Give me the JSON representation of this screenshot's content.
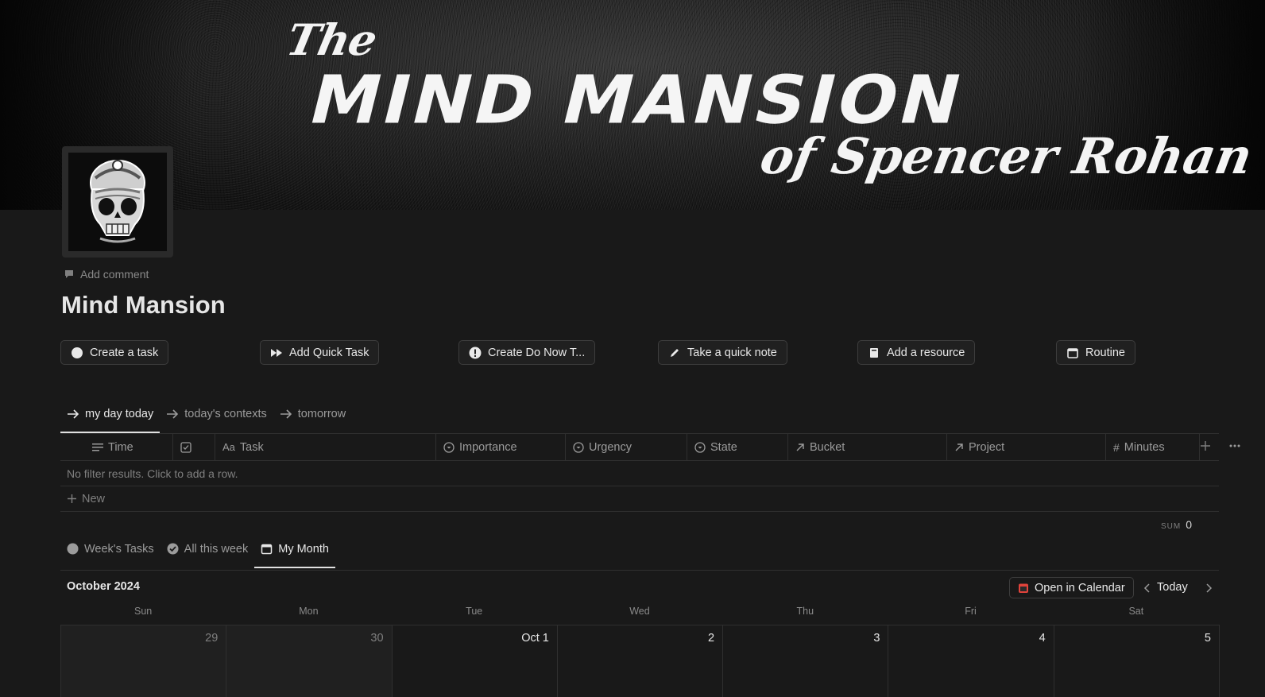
{
  "banner": {
    "line1": "The",
    "line2": "MIND MANSION",
    "line3": "of Spencer Rohan"
  },
  "page": {
    "add_comment": "Add comment",
    "title": "Mind Mansion"
  },
  "actions": [
    {
      "label": "Create a task",
      "icon": "circle-icon"
    },
    {
      "label": "Add Quick Task",
      "icon": "fast-forward-icon"
    },
    {
      "label": "Create Do Now T...",
      "icon": "exclamation-icon"
    },
    {
      "label": "Take a quick note",
      "icon": "pencil-icon"
    },
    {
      "label": "Add a resource",
      "icon": "book-icon"
    },
    {
      "label": "Routine",
      "icon": "calendar-icon"
    }
  ],
  "view_tabs_1": [
    {
      "label": "my day today",
      "icon": "arrow-right-icon",
      "active": true
    },
    {
      "label": "today's contexts",
      "icon": "arrow-right-icon",
      "active": false
    },
    {
      "label": "tomorrow",
      "icon": "arrow-right-icon",
      "active": false
    }
  ],
  "table": {
    "columns": [
      "Time",
      "",
      "Task",
      "Importance",
      "Urgency",
      "State",
      "Bucket",
      "Project",
      "Minutes"
    ],
    "empty_text": "No filter results. Click to add a row.",
    "new_label": "New",
    "sum_label": "SUM",
    "sum_value": "0"
  },
  "view_tabs_2": [
    {
      "label": "Week's Tasks",
      "icon": "circle-icon",
      "active": false
    },
    {
      "label": "All this week",
      "icon": "check-circle-icon",
      "active": false
    },
    {
      "label": "My Month",
      "icon": "calendar-icon",
      "active": true
    }
  ],
  "calendar": {
    "month": "October 2024",
    "open_label": "Open in Calendar",
    "today_label": "Today",
    "weekdays": [
      "Sun",
      "Mon",
      "Tue",
      "Wed",
      "Thu",
      "Fri",
      "Sat"
    ],
    "days": [
      "29",
      "30",
      "Oct 1",
      "2",
      "3",
      "4",
      "5"
    ]
  },
  "colors": {
    "background": "#191919",
    "border": "#2f2f2f",
    "text": "#e6e6e6",
    "muted": "#9b9b9b",
    "calendar_icon_red": "#e0433b"
  }
}
